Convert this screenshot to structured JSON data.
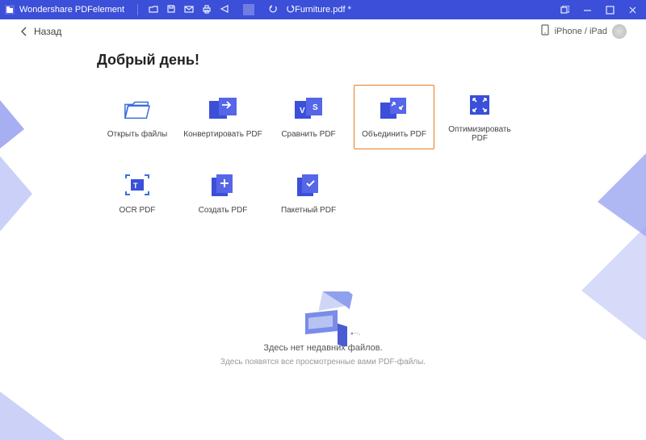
{
  "app": {
    "name": "Wondershare PDFelement",
    "doc_title": "Furniture.pdf *"
  },
  "secondbar": {
    "back_label": "Назад",
    "device_label": "iPhone / iPad"
  },
  "greeting": "Добрый день!",
  "actions": {
    "open": "Открыть файлы",
    "convert": "Конвертировать PDF",
    "compare": "Сравнить PDF",
    "combine": "Объединить PDF",
    "optimize": "Оптимизировать PDF",
    "ocr": "OCR PDF",
    "create": "Создать PDF",
    "batch": "Пакетный PDF"
  },
  "empty": {
    "title": "Здесь нет недавних файлов.",
    "subtitle": "Здесь появятся все просмотренные вами PDF-файлы."
  },
  "colors": {
    "brand": "#3b4fd9",
    "accent": "#e67e22"
  }
}
